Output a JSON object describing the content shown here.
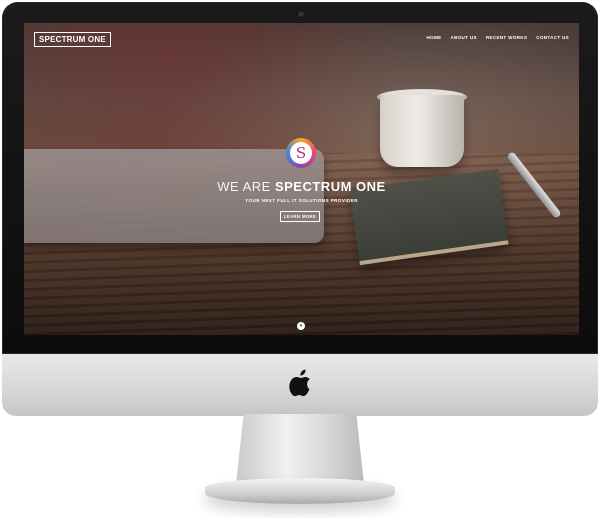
{
  "site": {
    "logo_text": "SPECTRUM ONE",
    "nav": [
      {
        "label": "HOME"
      },
      {
        "label": "ABOUT US"
      },
      {
        "label": "RECENT WORKS"
      },
      {
        "label": "CONTACT US"
      }
    ]
  },
  "hero": {
    "badge_letter": "S",
    "title_light": "WE ARE ",
    "title_bold": "SPECTRUM ONE",
    "subtitle": "YOUR NEXT FULL IT SOLUTIONS PROVIDER",
    "cta_label": "LEARN MORE",
    "scroll_icon": "chevron-down-icon"
  },
  "device": {
    "logo_icon": "apple-logo-icon"
  },
  "colors": {
    "bezel": "#111111",
    "text": "#ffffff",
    "badge_gradient": [
      "#f5a623",
      "#e8457a",
      "#8e44ad",
      "#3f87d8"
    ]
  }
}
